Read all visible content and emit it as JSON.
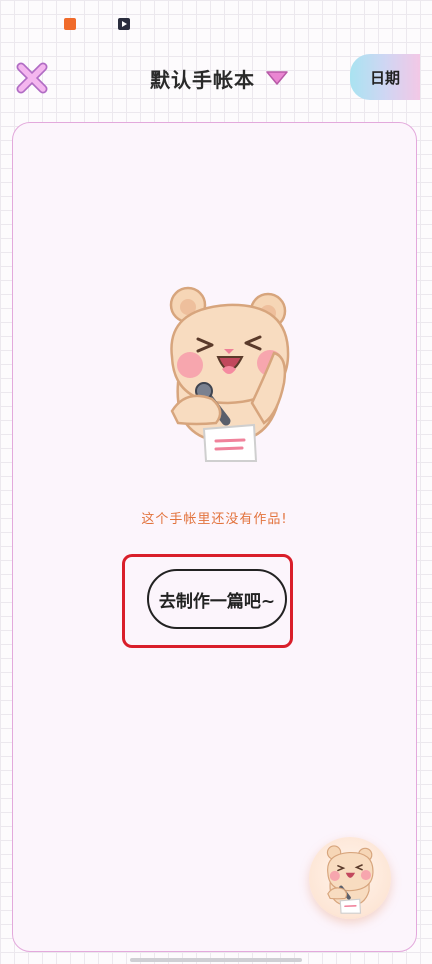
{
  "status_bar": {
    "icons": [
      "app-notification-icon",
      "video-app-icon"
    ]
  },
  "header": {
    "close_icon": "close-x-icon",
    "title": "默认手帐本",
    "dropdown_icon": "triangle-down-icon",
    "date_label": "日期"
  },
  "empty_state": {
    "illustration": "hamster-mascot-illustration",
    "message": "这个手帐里还没有作品!",
    "create_button_label": "去制作一篇吧~"
  },
  "fab": {
    "icon": "hamster-mascot-icon"
  },
  "colors": {
    "accent_pink": "#e98fd6",
    "message_orange": "#e2733d",
    "highlight_red": "#d91e2a",
    "card_border": "#e3a9dc"
  }
}
